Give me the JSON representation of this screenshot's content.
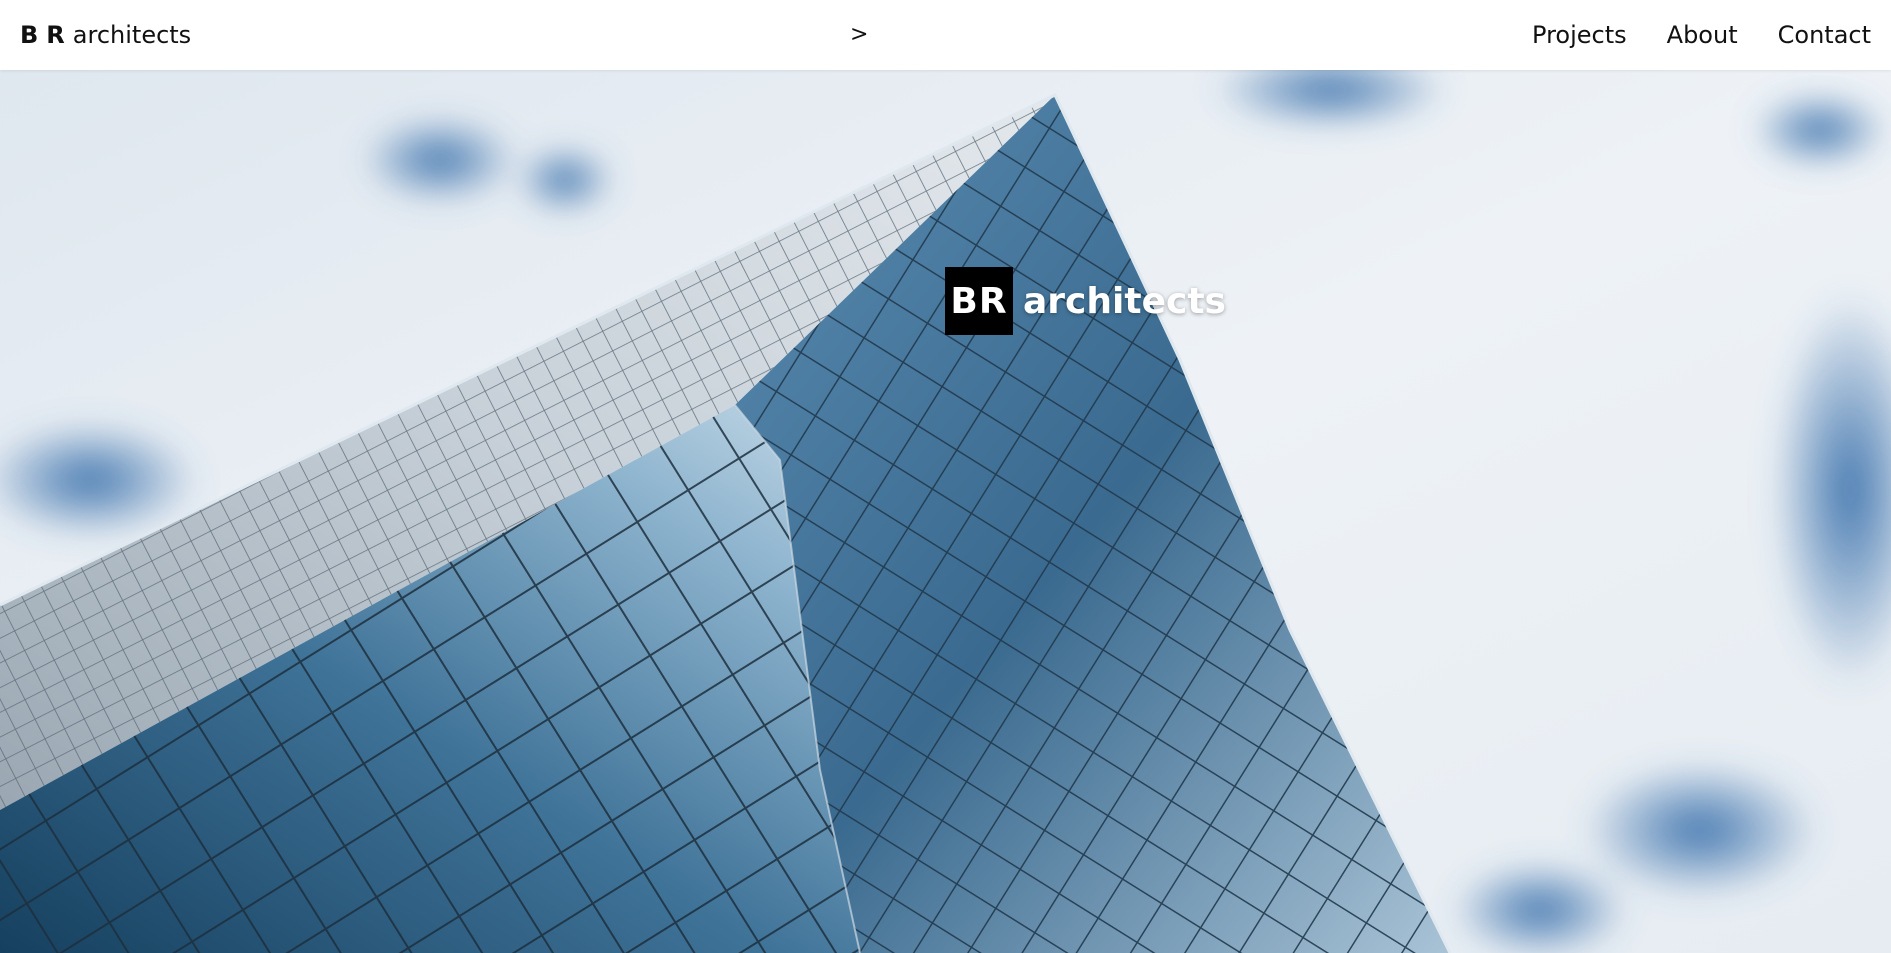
{
  "header": {
    "brand_initial_1": "B",
    "brand_initial_2": "R",
    "brand_word": "architects",
    "center_arrow": ">",
    "nav": [
      {
        "label": "Projects"
      },
      {
        "label": "About"
      },
      {
        "label": "Contact"
      }
    ]
  },
  "hero": {
    "logo_box": "BR",
    "logo_word": "architects",
    "image_subject": "glass skyscraper against cloudy blue sky"
  },
  "colors": {
    "header_bg": "#ffffff",
    "text": "#111111",
    "logo_box_bg": "#000000",
    "logo_text": "#ffffff",
    "sky_blue": "#4a7fb5",
    "glass_dark": "#1f4a6e"
  }
}
